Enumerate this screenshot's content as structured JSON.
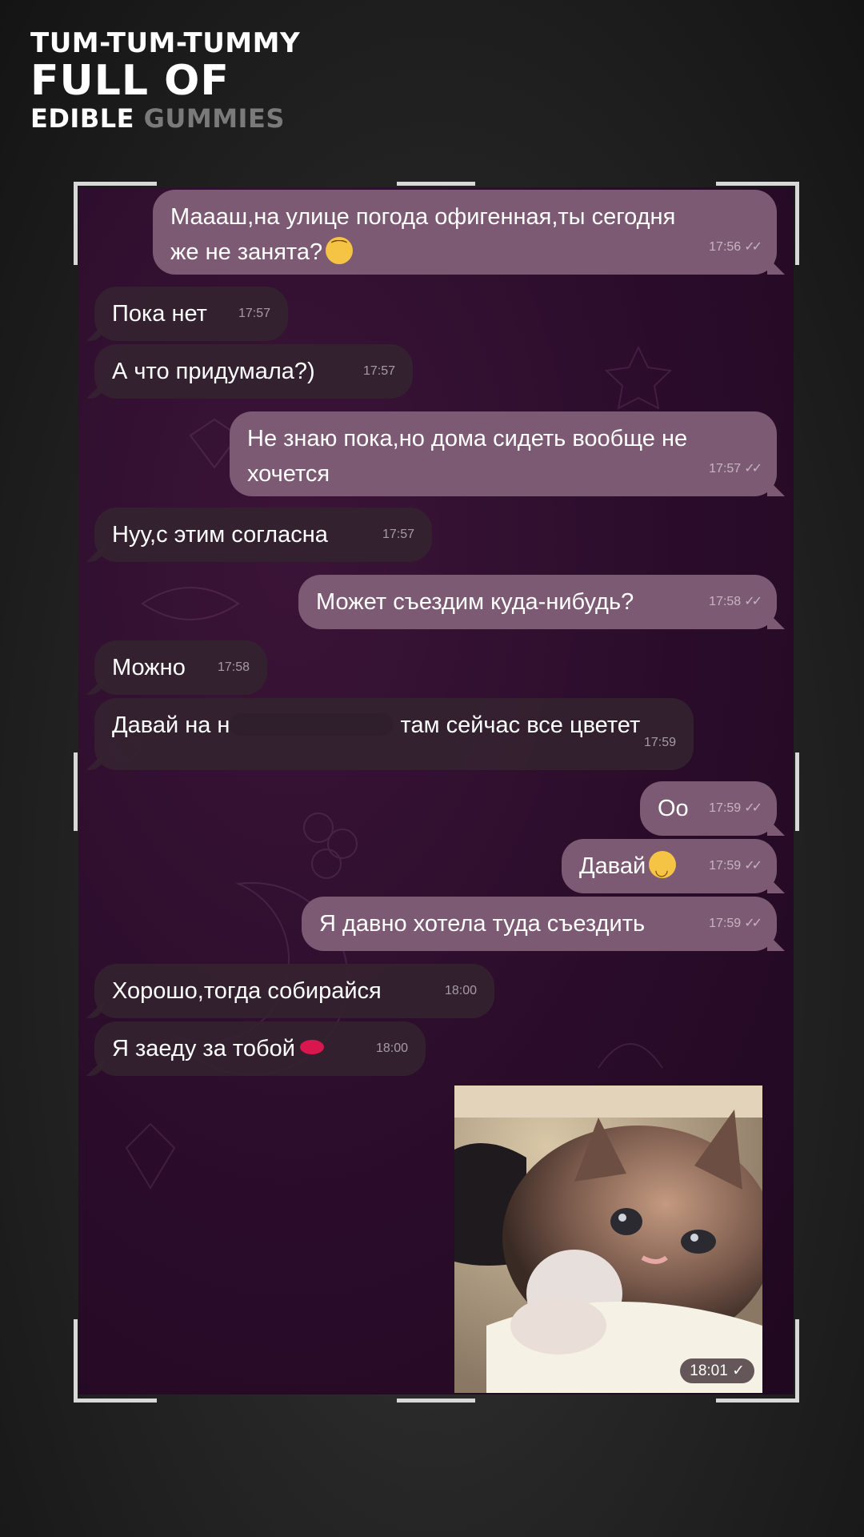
{
  "brand": {
    "line1": "TUM-TUM-TUMMY",
    "line2": "FULL OF",
    "line3_a": "EDIBLE",
    "line3_b": "GUMMIES"
  },
  "messages": [
    {
      "side": "out",
      "text_a": "Мааaш,на улице погода офигенная,ты сегодня",
      "text_b": "же не занята?",
      "time": "17:56"
    },
    {
      "side": "in",
      "text": "Пока нет",
      "time": "17:57"
    },
    {
      "side": "in",
      "text": "А что придумала?)",
      "time": "17:57"
    },
    {
      "side": "out",
      "text_a": "Не знаю пока,но дома сидеть вообще не",
      "text_b": "хочется",
      "time": "17:57"
    },
    {
      "side": "in",
      "text": "Нуу,с этим согласна",
      "time": "17:57"
    },
    {
      "side": "out",
      "text": "Может съездим куда-нибудь?",
      "time": "17:58"
    },
    {
      "side": "in",
      "text": "Можно",
      "time": "17:58"
    },
    {
      "side": "in",
      "text_a": "Давай на н",
      "text_b": "там сейчас все цветет",
      "time": "17:59"
    },
    {
      "side": "out",
      "text": "Оо",
      "time": "17:59"
    },
    {
      "side": "out",
      "text": "Давай",
      "time": "17:59"
    },
    {
      "side": "out",
      "text": "Я давно хотела туда съездить",
      "time": "17:59"
    },
    {
      "side": "in",
      "text": "Хорошо,тогда собирайся",
      "time": "18:00"
    },
    {
      "side": "in",
      "text": "Я заеду за тобой",
      "time": "18:00"
    }
  ],
  "photo": {
    "time": "18:01",
    "check": "✓"
  },
  "check_double": "✓✓",
  "colors": {
    "out_bubble": "#7d5a73",
    "in_bubble": "#342230",
    "chat_bg": "#2a0c2a"
  }
}
